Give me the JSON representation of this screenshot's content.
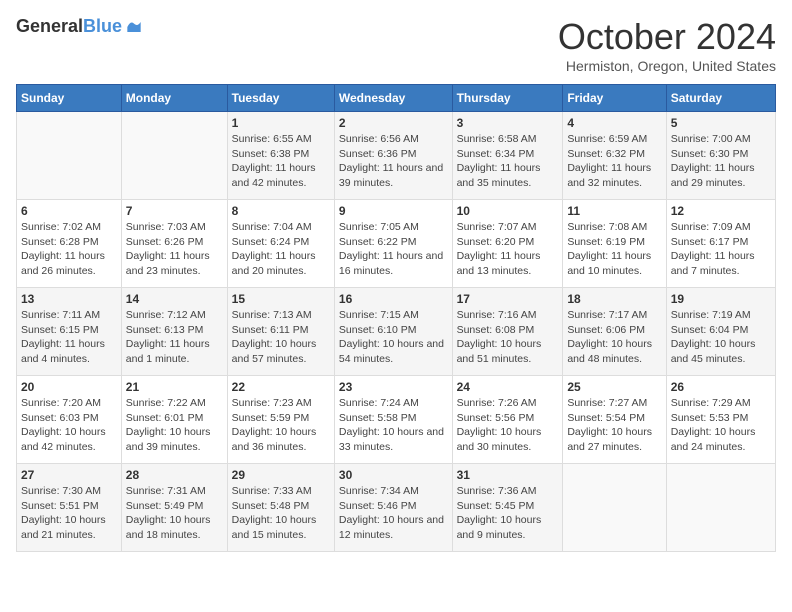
{
  "header": {
    "logo_line1": "General",
    "logo_line2": "Blue",
    "title": "October 2024",
    "subtitle": "Hermiston, Oregon, United States"
  },
  "calendar": {
    "days_of_week": [
      "Sunday",
      "Monday",
      "Tuesday",
      "Wednesday",
      "Thursday",
      "Friday",
      "Saturday"
    ],
    "weeks": [
      [
        {
          "day": "",
          "info": ""
        },
        {
          "day": "",
          "info": ""
        },
        {
          "day": "1",
          "info": "Sunrise: 6:55 AM\nSunset: 6:38 PM\nDaylight: 11 hours and 42 minutes."
        },
        {
          "day": "2",
          "info": "Sunrise: 6:56 AM\nSunset: 6:36 PM\nDaylight: 11 hours and 39 minutes."
        },
        {
          "day": "3",
          "info": "Sunrise: 6:58 AM\nSunset: 6:34 PM\nDaylight: 11 hours and 35 minutes."
        },
        {
          "day": "4",
          "info": "Sunrise: 6:59 AM\nSunset: 6:32 PM\nDaylight: 11 hours and 32 minutes."
        },
        {
          "day": "5",
          "info": "Sunrise: 7:00 AM\nSunset: 6:30 PM\nDaylight: 11 hours and 29 minutes."
        }
      ],
      [
        {
          "day": "6",
          "info": "Sunrise: 7:02 AM\nSunset: 6:28 PM\nDaylight: 11 hours and 26 minutes."
        },
        {
          "day": "7",
          "info": "Sunrise: 7:03 AM\nSunset: 6:26 PM\nDaylight: 11 hours and 23 minutes."
        },
        {
          "day": "8",
          "info": "Sunrise: 7:04 AM\nSunset: 6:24 PM\nDaylight: 11 hours and 20 minutes."
        },
        {
          "day": "9",
          "info": "Sunrise: 7:05 AM\nSunset: 6:22 PM\nDaylight: 11 hours and 16 minutes."
        },
        {
          "day": "10",
          "info": "Sunrise: 7:07 AM\nSunset: 6:20 PM\nDaylight: 11 hours and 13 minutes."
        },
        {
          "day": "11",
          "info": "Sunrise: 7:08 AM\nSunset: 6:19 PM\nDaylight: 11 hours and 10 minutes."
        },
        {
          "day": "12",
          "info": "Sunrise: 7:09 AM\nSunset: 6:17 PM\nDaylight: 11 hours and 7 minutes."
        }
      ],
      [
        {
          "day": "13",
          "info": "Sunrise: 7:11 AM\nSunset: 6:15 PM\nDaylight: 11 hours and 4 minutes."
        },
        {
          "day": "14",
          "info": "Sunrise: 7:12 AM\nSunset: 6:13 PM\nDaylight: 11 hours and 1 minute."
        },
        {
          "day": "15",
          "info": "Sunrise: 7:13 AM\nSunset: 6:11 PM\nDaylight: 10 hours and 57 minutes."
        },
        {
          "day": "16",
          "info": "Sunrise: 7:15 AM\nSunset: 6:10 PM\nDaylight: 10 hours and 54 minutes."
        },
        {
          "day": "17",
          "info": "Sunrise: 7:16 AM\nSunset: 6:08 PM\nDaylight: 10 hours and 51 minutes."
        },
        {
          "day": "18",
          "info": "Sunrise: 7:17 AM\nSunset: 6:06 PM\nDaylight: 10 hours and 48 minutes."
        },
        {
          "day": "19",
          "info": "Sunrise: 7:19 AM\nSunset: 6:04 PM\nDaylight: 10 hours and 45 minutes."
        }
      ],
      [
        {
          "day": "20",
          "info": "Sunrise: 7:20 AM\nSunset: 6:03 PM\nDaylight: 10 hours and 42 minutes."
        },
        {
          "day": "21",
          "info": "Sunrise: 7:22 AM\nSunset: 6:01 PM\nDaylight: 10 hours and 39 minutes."
        },
        {
          "day": "22",
          "info": "Sunrise: 7:23 AM\nSunset: 5:59 PM\nDaylight: 10 hours and 36 minutes."
        },
        {
          "day": "23",
          "info": "Sunrise: 7:24 AM\nSunset: 5:58 PM\nDaylight: 10 hours and 33 minutes."
        },
        {
          "day": "24",
          "info": "Sunrise: 7:26 AM\nSunset: 5:56 PM\nDaylight: 10 hours and 30 minutes."
        },
        {
          "day": "25",
          "info": "Sunrise: 7:27 AM\nSunset: 5:54 PM\nDaylight: 10 hours and 27 minutes."
        },
        {
          "day": "26",
          "info": "Sunrise: 7:29 AM\nSunset: 5:53 PM\nDaylight: 10 hours and 24 minutes."
        }
      ],
      [
        {
          "day": "27",
          "info": "Sunrise: 7:30 AM\nSunset: 5:51 PM\nDaylight: 10 hours and 21 minutes."
        },
        {
          "day": "28",
          "info": "Sunrise: 7:31 AM\nSunset: 5:49 PM\nDaylight: 10 hours and 18 minutes."
        },
        {
          "day": "29",
          "info": "Sunrise: 7:33 AM\nSunset: 5:48 PM\nDaylight: 10 hours and 15 minutes."
        },
        {
          "day": "30",
          "info": "Sunrise: 7:34 AM\nSunset: 5:46 PM\nDaylight: 10 hours and 12 minutes."
        },
        {
          "day": "31",
          "info": "Sunrise: 7:36 AM\nSunset: 5:45 PM\nDaylight: 10 hours and 9 minutes."
        },
        {
          "day": "",
          "info": ""
        },
        {
          "day": "",
          "info": ""
        }
      ]
    ]
  }
}
